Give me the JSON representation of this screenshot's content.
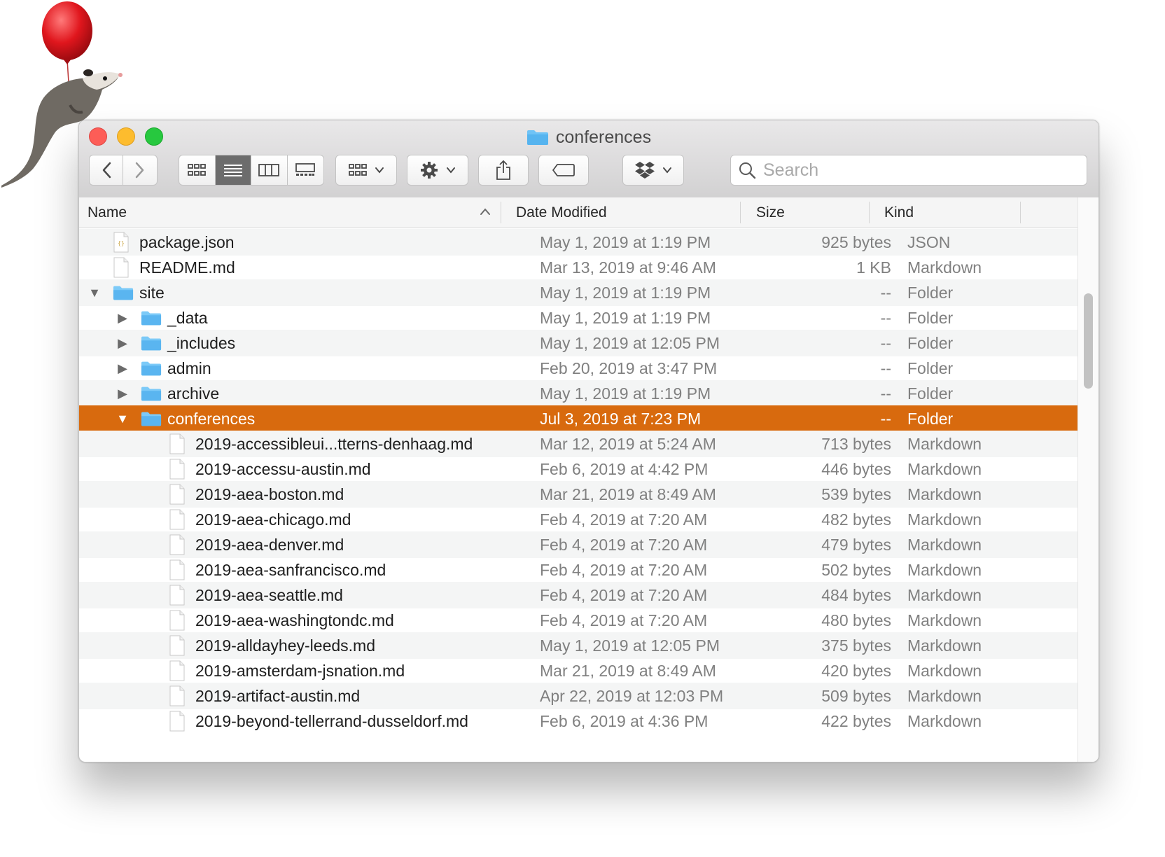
{
  "window": {
    "title": "conferences"
  },
  "toolbar": {
    "back_icon": "chevron-left-icon",
    "forward_icon": "chevron-right-icon",
    "view_modes": [
      "icon-view-icon",
      "list-view-icon",
      "column-view-icon",
      "gallery-view-icon"
    ],
    "active_view": "list-view-icon",
    "group_icon": "group-by-icon",
    "action_icon": "gear-icon",
    "share_icon": "share-icon",
    "tag_icon": "tag-icon",
    "dropbox_icon": "dropbox-icon",
    "search_placeholder": "Search"
  },
  "columns": {
    "name": "Name",
    "date_modified": "Date Modified",
    "size": "Size",
    "kind": "Kind",
    "sort_indicator": "^"
  },
  "colors": {
    "selection": "#d86a0e",
    "folder": "#5ab5f0",
    "close": "#fd5d57",
    "minimize": "#fdbc2e",
    "zoom": "#27c83f"
  },
  "rows": [
    {
      "name": "package.json",
      "date": "May 1, 2019 at 1:19 PM",
      "size": "925 bytes",
      "kind": "JSON",
      "icon": "json-file-icon",
      "depth": 0,
      "disclosure": ""
    },
    {
      "name": "README.md",
      "date": "Mar 13, 2019 at 9:46 AM",
      "size": "1 KB",
      "kind": "Markdown",
      "icon": "document-icon",
      "depth": 0,
      "disclosure": ""
    },
    {
      "name": "site",
      "date": "May 1, 2019 at 1:19 PM",
      "size": "--",
      "kind": "Folder",
      "icon": "folder-icon",
      "depth": 0,
      "disclosure": "expanded"
    },
    {
      "name": "_data",
      "date": "May 1, 2019 at 1:19 PM",
      "size": "--",
      "kind": "Folder",
      "icon": "folder-icon",
      "depth": 1,
      "disclosure": "collapsed"
    },
    {
      "name": "_includes",
      "date": "May 1, 2019 at 12:05 PM",
      "size": "--",
      "kind": "Folder",
      "icon": "folder-icon",
      "depth": 1,
      "disclosure": "collapsed"
    },
    {
      "name": "admin",
      "date": "Feb 20, 2019 at 3:47 PM",
      "size": "--",
      "kind": "Folder",
      "icon": "folder-icon",
      "depth": 1,
      "disclosure": "collapsed"
    },
    {
      "name": "archive",
      "date": "May 1, 2019 at 1:19 PM",
      "size": "--",
      "kind": "Folder",
      "icon": "folder-icon",
      "depth": 1,
      "disclosure": "collapsed"
    },
    {
      "name": "conferences",
      "date": "Jul 3, 2019 at 7:23 PM",
      "size": "--",
      "kind": "Folder",
      "icon": "folder-icon",
      "depth": 1,
      "disclosure": "expanded",
      "selected": true
    },
    {
      "name": "2019-accessibleui...tterns-denhaag.md",
      "date": "Mar 12, 2019 at 5:24 AM",
      "size": "713 bytes",
      "kind": "Markdown",
      "icon": "document-icon",
      "depth": 2,
      "disclosure": ""
    },
    {
      "name": "2019-accessu-austin.md",
      "date": "Feb 6, 2019 at 4:42 PM",
      "size": "446 bytes",
      "kind": "Markdown",
      "icon": "document-icon",
      "depth": 2,
      "disclosure": ""
    },
    {
      "name": "2019-aea-boston.md",
      "date": "Mar 21, 2019 at 8:49 AM",
      "size": "539 bytes",
      "kind": "Markdown",
      "icon": "document-icon",
      "depth": 2,
      "disclosure": ""
    },
    {
      "name": "2019-aea-chicago.md",
      "date": "Feb 4, 2019 at 7:20 AM",
      "size": "482 bytes",
      "kind": "Markdown",
      "icon": "document-icon",
      "depth": 2,
      "disclosure": ""
    },
    {
      "name": "2019-aea-denver.md",
      "date": "Feb 4, 2019 at 7:20 AM",
      "size": "479 bytes",
      "kind": "Markdown",
      "icon": "document-icon",
      "depth": 2,
      "disclosure": ""
    },
    {
      "name": "2019-aea-sanfrancisco.md",
      "date": "Feb 4, 2019 at 7:20 AM",
      "size": "502 bytes",
      "kind": "Markdown",
      "icon": "document-icon",
      "depth": 2,
      "disclosure": ""
    },
    {
      "name": "2019-aea-seattle.md",
      "date": "Feb 4, 2019 at 7:20 AM",
      "size": "484 bytes",
      "kind": "Markdown",
      "icon": "document-icon",
      "depth": 2,
      "disclosure": ""
    },
    {
      "name": "2019-aea-washingtondc.md",
      "date": "Feb 4, 2019 at 7:20 AM",
      "size": "480 bytes",
      "kind": "Markdown",
      "icon": "document-icon",
      "depth": 2,
      "disclosure": ""
    },
    {
      "name": "2019-alldayhey-leeds.md",
      "date": "May 1, 2019 at 12:05 PM",
      "size": "375 bytes",
      "kind": "Markdown",
      "icon": "document-icon",
      "depth": 2,
      "disclosure": ""
    },
    {
      "name": "2019-amsterdam-jsnation.md",
      "date": "Mar 21, 2019 at 8:49 AM",
      "size": "420 bytes",
      "kind": "Markdown",
      "icon": "document-icon",
      "depth": 2,
      "disclosure": ""
    },
    {
      "name": "2019-artifact-austin.md",
      "date": "Apr 22, 2019 at 12:03 PM",
      "size": "509 bytes",
      "kind": "Markdown",
      "icon": "document-icon",
      "depth": 2,
      "disclosure": ""
    },
    {
      "name": "2019-beyond-tellerrand-dusseldorf.md",
      "date": "Feb 6, 2019 at 4:36 PM",
      "size": "422 bytes",
      "kind": "Markdown",
      "icon": "document-icon",
      "depth": 2,
      "disclosure": ""
    }
  ]
}
